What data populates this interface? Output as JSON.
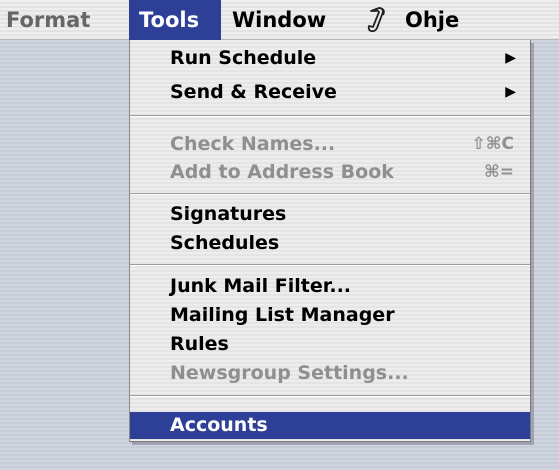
{
  "menubar": {
    "items": [
      {
        "label": "Format",
        "state": "disabled"
      },
      {
        "label": "Tools",
        "state": "open"
      },
      {
        "label": "Window",
        "state": "normal"
      },
      {
        "label": "Ohje",
        "state": "normal"
      }
    ],
    "script_icon": "script-scroll-icon"
  },
  "tools_menu": {
    "items": [
      {
        "label": "Run Schedule",
        "submenu": true,
        "enabled": true
      },
      {
        "label": "Send & Receive",
        "submenu": true,
        "enabled": true
      },
      {
        "label": "Check Names...",
        "shortcut": "⇧⌘C",
        "enabled": false
      },
      {
        "label": "Add to Address Book",
        "shortcut": "⌘=",
        "enabled": false
      },
      {
        "label": "Signatures",
        "enabled": true
      },
      {
        "label": "Schedules",
        "enabled": true
      },
      {
        "label": "Junk Mail Filter...",
        "enabled": true
      },
      {
        "label": "Mailing List Manager",
        "enabled": true
      },
      {
        "label": "Rules",
        "enabled": true
      },
      {
        "label": "Newsgroup Settings...",
        "enabled": false
      },
      {
        "label": "Accounts",
        "enabled": true,
        "selected": true
      }
    ],
    "submenu_arrow": "▶"
  },
  "colors": {
    "highlight": "#2d3f97",
    "disabled_text": "#8f8f8f",
    "menu_bg": "#ededed"
  }
}
